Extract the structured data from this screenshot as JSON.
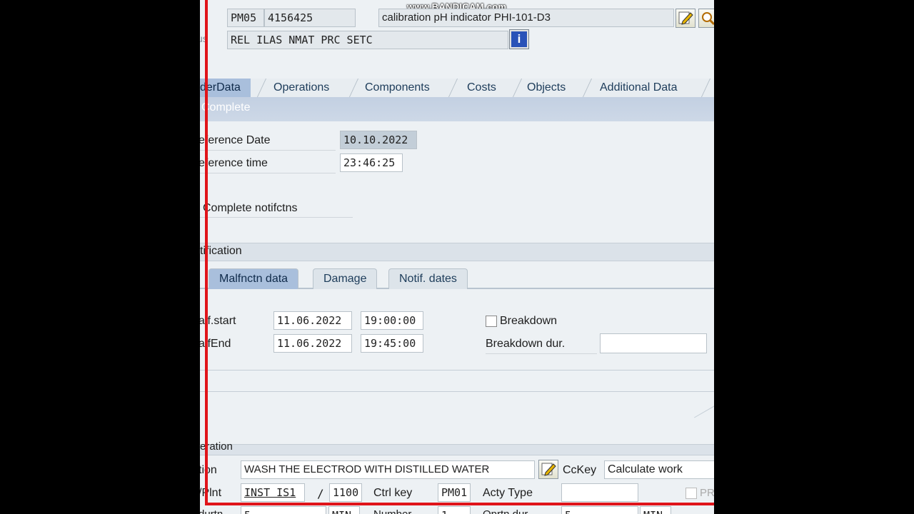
{
  "watermark": "www.BANDICAM.com",
  "header": {
    "order_type": "PM05",
    "order_number": "4156425",
    "description": "calibration pH indicator PHI-101-D3",
    "status_label_fragment": "us",
    "status": "REL  ILAS NMAT PRC  SETC"
  },
  "tabs": [
    "derData",
    "Operations",
    "Components",
    "Costs",
    "Objects",
    "Additional Data"
  ],
  "complete_section": {
    "title": "Complete",
    "ref_date_label": "eference Date",
    "ref_date": "10.10.2022",
    "ref_time_label": "eference time",
    "ref_time": "23:46:25",
    "complete_notif_label": "Complete notifctns"
  },
  "notification_section": {
    "title": "tification",
    "subtabs": [
      "Malfnctn data",
      "Damage",
      "Notif. dates"
    ],
    "malf_start_label": "alf.start",
    "malf_start_date": "11.06.2022",
    "malf_start_time": "19:00:00",
    "malf_end_label": "alfEnd",
    "malf_end_date": "11.06.2022",
    "malf_end_time": "19:45:00",
    "breakdown_label": "Breakdown",
    "breakdown_dur_label": "Breakdown dur.",
    "breakdown_dur_value": ""
  },
  "operation_section": {
    "title": "eration",
    "op_text_label": "tion",
    "op_text": "WASH THE ELECTROD WITH DISTILLED WATER",
    "cckey_label": "CcKey",
    "cckey_value": "Calculate work",
    "plnt_label": "/Plnt",
    "workctr": "INST IS1",
    "slash": "/",
    "plant": "1100",
    "ctrl_key_label": "Ctrl key",
    "ctrl_key": "PM01",
    "acty_type_label": "Acty Type",
    "acty_type": "",
    "pr_label": "PR",
    "row3_label": "durtn",
    "row3_value": "5",
    "row3_unit": "MIN",
    "number_label": "Number",
    "number_value": "1",
    "oprtn_dur_label": "Oprtn dur.",
    "oprtn_dur_value": "5",
    "oprtn_dur_unit": "MIN"
  },
  "colors": {
    "frame_red": "#e0141a",
    "section_header": "#c8d4e4",
    "active_tab": "#a9bfdc"
  }
}
